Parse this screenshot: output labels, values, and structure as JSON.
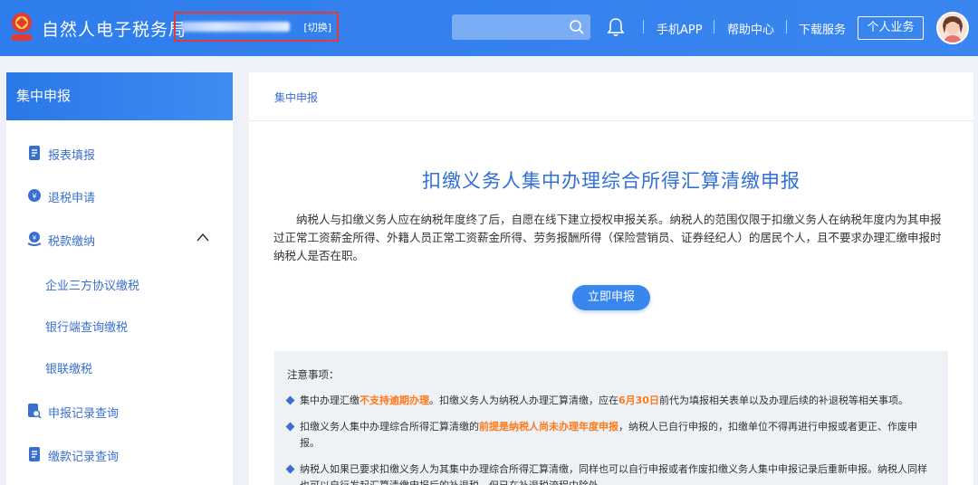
{
  "header": {
    "site_title": "自然人电子税务局",
    "switch_label": "[切换]",
    "nav": [
      "手机APP",
      "帮助中心",
      "下载服务"
    ],
    "personal_button": "个人业务",
    "brand_color": "#3a86f0"
  },
  "sidebar": {
    "title": "集中申报",
    "items": [
      {
        "label": "报表填报",
        "icon": "form-icon"
      },
      {
        "label": "退税申请",
        "icon": "refund-icon"
      },
      {
        "label": "税款缴纳",
        "icon": "payment-icon"
      },
      {
        "label": "申报记录查询",
        "icon": "record-search-icon"
      },
      {
        "label": "缴款记录查询",
        "icon": "payment-record-icon"
      }
    ],
    "sub_items": [
      "企业三方协议缴税",
      "银行端查询缴税",
      "银联缴税"
    ]
  },
  "main": {
    "breadcrumb": "集中申报",
    "title": "扣缴义务人集中办理综合所得汇算清缴申报",
    "description": "纳税人与扣缴义务人应在纳税年度终了后，自愿在线下建立授权申报关系。纳税人的范围仅限于扣缴义务人在纳税年度内为其申报过正常工资薪金所得、外籍人员正常工资薪金所得、劳务报酬所得（保险营销员、证券经纪人）的居民个人，且不要求办理汇缴申报时纳税人是否在职。",
    "declare_button": "立即申报",
    "notice": {
      "title": "注意事项：",
      "item1": {
        "a": "集中办理汇缴",
        "b": "不支持逾期办理",
        "c": "。扣缴义务人为纳税人办理汇算清缴，应在",
        "d": "6月30日",
        "e": "前代为填报相关表单以及办理后续的补退税等相关事项。"
      },
      "item2": {
        "a": "扣缴义务人集中办理综合所得汇算清缴的",
        "b": "前提是纳税人尚未办理年度申报",
        "c": "，纳税人已自行申报的，扣缴单位不得再进行申报或者更正、作废申报。"
      },
      "item3": "纳税人如果已要求扣缴义务人为其集中办理综合所得汇算清缴，同样也可以自行申报或者作废扣缴义务人集中申报记录后重新申报。纳税人同样也可以自行发起汇算清缴申报后的补退税，但已在补退税流程中除外。"
    }
  }
}
